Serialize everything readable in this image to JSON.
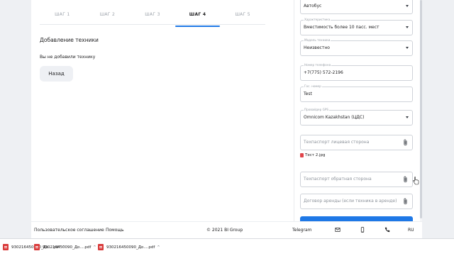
{
  "steps": [
    {
      "label": "ШАГ 1"
    },
    {
      "label": "ШАГ 2"
    },
    {
      "label": "ШАГ 3"
    },
    {
      "label": "ШАГ 4"
    },
    {
      "label": "ШАГ 5"
    }
  ],
  "active_step": 4,
  "main": {
    "section_title": "Добавление техники",
    "empty_note": "Вы не добавили технику",
    "back_label": "Назад"
  },
  "form": {
    "vehicle_type": {
      "value": "Автобус"
    },
    "feature": {
      "label": "Характеристика",
      "value": "Вместимость более 10 пасс. мест"
    },
    "model": {
      "label": "Модель техники",
      "value": "Неизвестно"
    },
    "phone": {
      "label": "Номер телефона",
      "value": "+7(775) 572-2196"
    },
    "plate": {
      "label": "Гос. номер",
      "value": "Test"
    },
    "gps": {
      "label": "Провайдер GPS",
      "value": "Omnicom Kazakhstan (ЦДС)"
    },
    "passport_front": {
      "placeholder": "Техпаспорт лицевая сторона"
    },
    "uploaded_file": "Тест 2.jpg",
    "passport_back": {
      "placeholder": "Техпаспорт обратная сторона"
    },
    "lease": {
      "placeholder": "Договор аренды (если техника в аренде)"
    }
  },
  "footer": {
    "agreement": "Пользовательское соглашение",
    "help": "Помощь",
    "copyright": "© 2021 BI Group",
    "telegram": "Telegram",
    "lang": "RU"
  },
  "downloads": [
    {
      "name": "930216450090_До....pdf",
      "size": "^"
    },
    {
      "name": "930216450090_До....pdf",
      "size": "^"
    },
    {
      "name": "930216450090_До....pdf",
      "size": "^"
    }
  ],
  "colors": {
    "accent": "#1e78e6",
    "pdf": "#d93a3a"
  }
}
